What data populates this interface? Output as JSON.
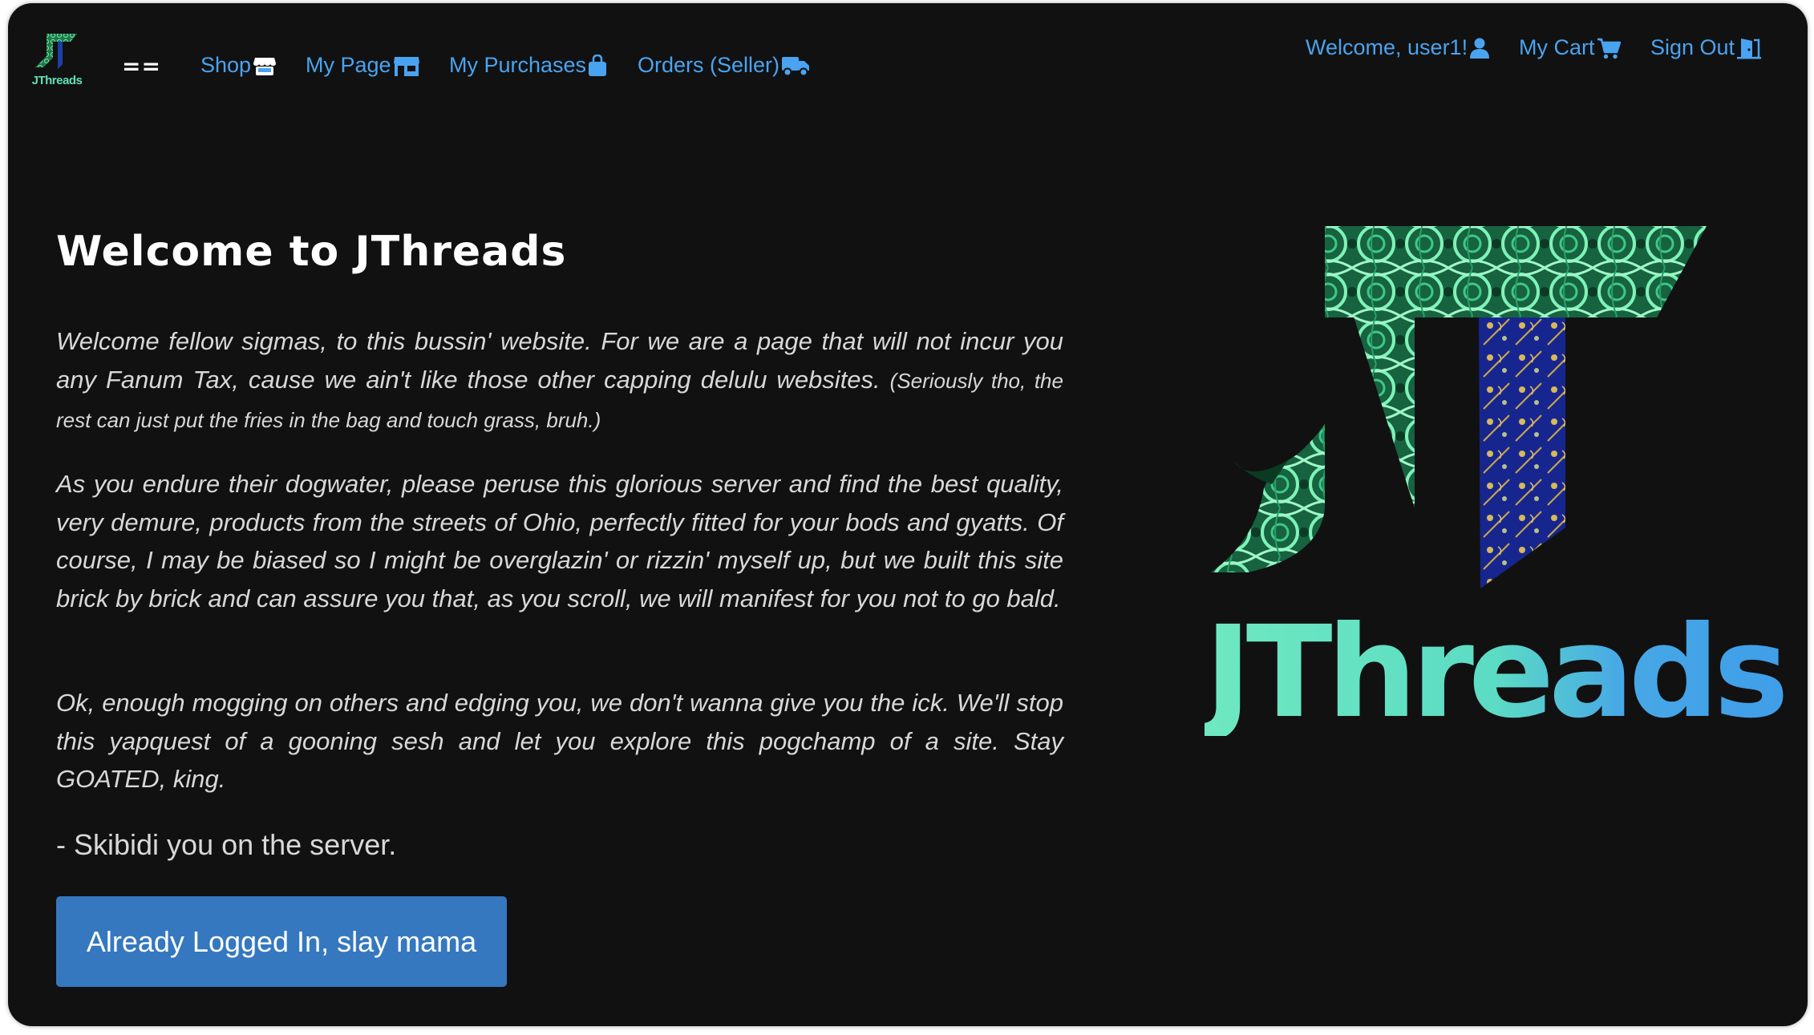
{
  "app": {
    "logo_text": "JThreads",
    "accent_color": "#4aa3f0",
    "button_color": "#3578bf",
    "background_color": "#111111"
  },
  "nav": {
    "menu_toggle": "==",
    "left_links": [
      {
        "label": "Shop",
        "icon": "store-icon"
      },
      {
        "label": "My Page",
        "icon": "shop-icon"
      },
      {
        "label": "My Purchases",
        "icon": "shopping-bag-icon"
      },
      {
        "label": "Orders (Seller)",
        "icon": "truck-icon"
      }
    ],
    "right_links": [
      {
        "label": "Welcome, user1!",
        "icon": "user-icon"
      },
      {
        "label": "My Cart",
        "icon": "cart-icon"
      },
      {
        "label": "Sign Out",
        "icon": "door-icon"
      }
    ]
  },
  "main": {
    "title": "Welcome to JThreads",
    "paragraph1": "Welcome fellow sigmas, to this bussin' website. For we are a page that will not incur you any Fanum Tax, cause we ain't like those other capping delulu websites.",
    "paragraph1_small": "(Seriously tho, the rest can just put the fries in the bag and touch grass, bruh.)",
    "paragraph2": "As you endure their dogwater, please peruse this glorious server and find the best quality, very demure, products from the streets of Ohio, perfectly fitted for your bods and gyatts. Of course, I may be biased so I might be overglazin' or rizzin' myself up, but we built this site brick by brick and can assure you that, as you scroll, we will manifest for you not to go bald.",
    "paragraph3": "Ok, enough mogging on others and edging you, we don't wanna give you the ick. We'll stop this yapquest of a gooning sesh and let you explore this pogchamp of a site. Stay GOATED, king.",
    "signoff": "- Skibidi you on the server.",
    "cta_label": "Already Logged In, slay mama"
  },
  "hero": {
    "wordmark": "JThreads"
  }
}
